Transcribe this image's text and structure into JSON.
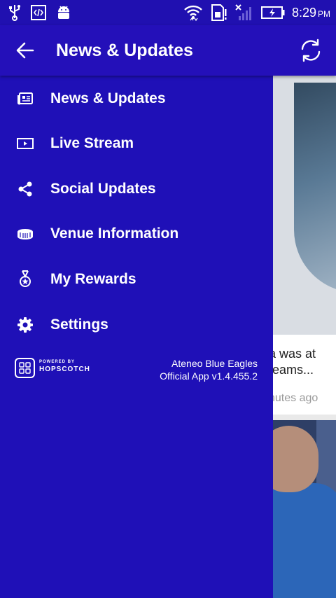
{
  "status_bar": {
    "time": "8:29",
    "ampm": "PM",
    "icons": [
      "usb-icon",
      "code-icon",
      "android-icon",
      "wifi-icon",
      "sim-icon",
      "signal-icon",
      "battery-icon"
    ]
  },
  "app_bar": {
    "title": "News & Updates",
    "back_icon": "arrow-left-icon",
    "refresh_icon": "refresh-icon"
  },
  "drawer": {
    "items": [
      {
        "label": "News & Updates",
        "icon": "newspaper-icon"
      },
      {
        "label": "Live Stream",
        "icon": "play-icon"
      },
      {
        "label": "Social Updates",
        "icon": "share-icon"
      },
      {
        "label": "Venue Information",
        "icon": "stadium-icon"
      },
      {
        "label": "My Rewards",
        "icon": "medal-icon"
      },
      {
        "label": "Settings",
        "icon": "gear-icon"
      }
    ],
    "footer": {
      "powered_by": "POWERED BY",
      "brand": "HOPSCOTCH",
      "app_name": "Ateneo Blue Eagles",
      "app_version": "Official App v1.4.455.2"
    }
  },
  "background": {
    "card_text_line1": "a was at",
    "card_text_line2": "teams...",
    "card_time": "nutes ago"
  },
  "colors": {
    "primary": "#2410b9",
    "drawer": "#1f10b7",
    "text": "#ffffff"
  }
}
